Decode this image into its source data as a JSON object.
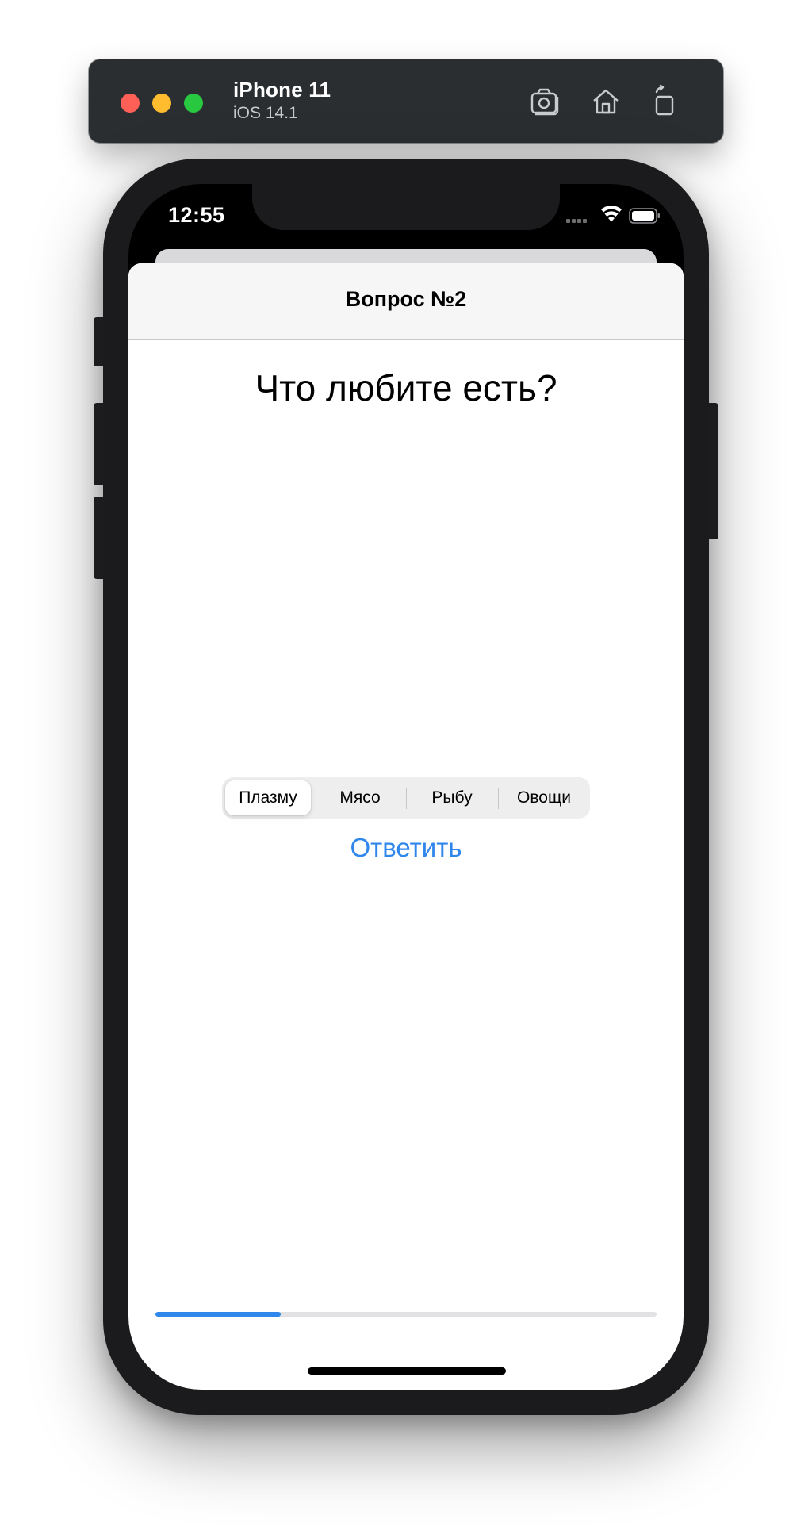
{
  "simulator": {
    "device_name": "iPhone 11",
    "os_version": "iOS 14.1",
    "traffic_lights": {
      "close": "#fe5f57",
      "minimize": "#febc2e",
      "zoom": "#28c840"
    },
    "toolbar_icons": [
      "screenshot-icon",
      "home-icon",
      "rotate-icon"
    ]
  },
  "status_bar": {
    "time": "12:55",
    "icons": [
      "cellular-icon",
      "wifi-icon",
      "battery-icon"
    ]
  },
  "nav": {
    "title": "Вопрос №2"
  },
  "question": {
    "text": "Что любите есть?"
  },
  "segmented_control": {
    "options": [
      "Плазму",
      "Мясо",
      "Рыбу",
      "Овощи"
    ],
    "selected": "Плазму"
  },
  "answer_button": {
    "label": "Ответить"
  },
  "progress": {
    "value": 0.25,
    "color": "#2f86eb"
  },
  "colors": {
    "accent": "#2f86eb",
    "frame": "#1b1b1d",
    "titlebar": "#2a2e30"
  }
}
